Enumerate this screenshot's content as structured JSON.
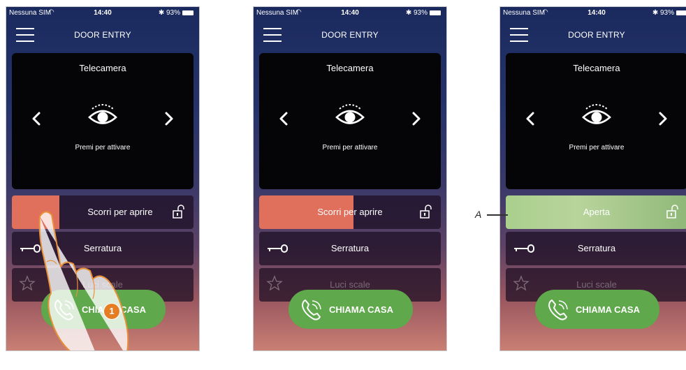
{
  "statusbar": {
    "carrier": "Nessuna SIM",
    "time": "14:40",
    "battery": "93%"
  },
  "header": {
    "title": "DOOR ENTRY",
    "menu_icon": "hamburger-icon"
  },
  "camera": {
    "title": "Telecamera",
    "hint": "Premi per attivare",
    "icons": [
      "chevron-left-icon",
      "eye-icon",
      "chevron-right-icon"
    ]
  },
  "panels": [
    {
      "slider_label": "Scorri per aprire",
      "lock_label": "Serratura",
      "lights_label": "Luci scale",
      "call_label": "CHIAMA CASA",
      "slider_progress": 0.26,
      "step": "1"
    },
    {
      "slider_label": "Scorri per aprire",
      "lock_label": "Serratura",
      "lights_label": "Luci scale",
      "call_label": "CHIAMA CASA",
      "slider_progress": 0.52
    },
    {
      "slider_label": "Aperta",
      "lock_label": "Serratura",
      "lights_label": "Luci scale",
      "call_label": "CHIAMA CASA",
      "slider_progress": 1.0
    }
  ],
  "annotation": {
    "label": "A"
  },
  "colors": {
    "slider": "#e0705c",
    "open": "#a9d08c",
    "call": "#5fa84c",
    "badge": "#e67d22"
  }
}
